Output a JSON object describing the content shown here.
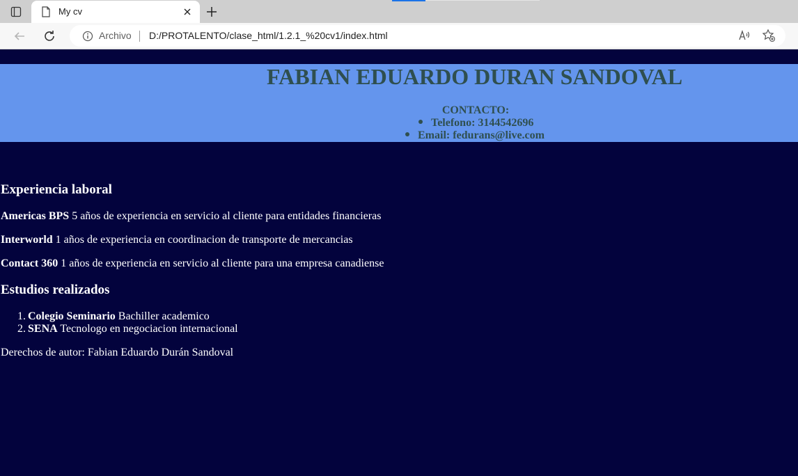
{
  "browser": {
    "tab_title": "My cv",
    "address_scheme": "Archivo",
    "url": "D:/PROTALENTO/clase_html/1.2.1_%20cv1/index.html"
  },
  "header": {
    "name": "FABIAN EDUARDO DURAN SANDOVAL",
    "contact_title": "CONTACTO:",
    "contact_items": [
      "Telefono: 3144542696",
      "Email: fedurans@live.com"
    ]
  },
  "experience": {
    "heading": "Experiencia laboral",
    "jobs": [
      {
        "company": "Americas BPS",
        "desc": " 5 años de experiencia en servicio al cliente para entidades financieras"
      },
      {
        "company": "Interworld",
        "desc": " 1 años de experiencia en coordinacion de transporte de mercancias"
      },
      {
        "company": "Contact 360",
        "desc": " 1 años de experiencia en servicio al cliente para una empresa canadiense"
      }
    ]
  },
  "education": {
    "heading": "Estudios realizados",
    "items": [
      {
        "num": "1.",
        "school": "Colegio Seminario",
        "desc": " Bachiller academico"
      },
      {
        "num": "2.",
        "school": "SENA",
        "desc": " Tecnologo en negociacion internacional"
      }
    ]
  },
  "footer": "Derechos de autor: Fabian Eduardo Durán Sandoval",
  "colors": {
    "background": "#03033d",
    "header_bg": "#6495ed",
    "header_text": "#2f4f4f"
  }
}
